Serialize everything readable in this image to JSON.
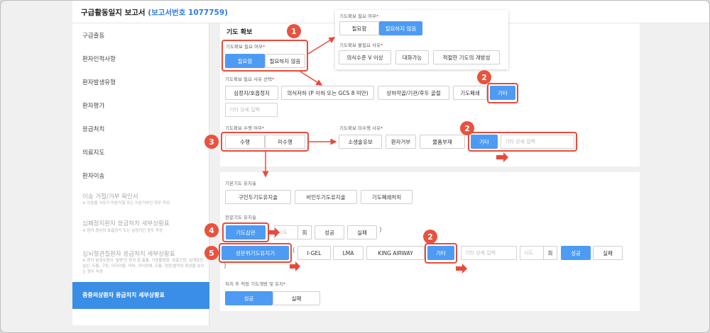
{
  "header": {
    "title": "구급활동일지 보고서",
    "report_no": "(보고서번호 1077759)"
  },
  "sidebar": {
    "items": [
      {
        "label": "구급출동"
      },
      {
        "label": "환자인적사항"
      },
      {
        "label": "환자발생유형"
      },
      {
        "label": "환자평가"
      },
      {
        "label": "응급처치"
      },
      {
        "label": "의료지도"
      },
      {
        "label": "환자이송"
      },
      {
        "label": "이송 거절/거부 확인서",
        "sub": "※ 이송을 사유가 미송거절 또는 이송거부인 경우 작성"
      },
      {
        "label": "심폐정지환자 응급처치 세부상황표",
        "sub": "※ 환자 증상이 호흡정지 또는 심정지인 경우 작성"
      },
      {
        "label": "심뇌혈관질환자 응급처치 세부상황표",
        "sub": "※ 환자 발생유형이 '질병'인 환자 중 흉통, 가슴불편함, 호흡곤란, 심계항진, 실신, 두통, 구토, 어지러움, 마비, 의식장애, 두통, 경련/발작의 증상을 보이는 경우 작성"
      },
      {
        "label": "중증외상환자 응급처치 세부상황표",
        "active": true
      }
    ]
  },
  "section_title": "기도 확보",
  "airway_need": {
    "label": "기도확보 필요 여부",
    "options": [
      "필요함",
      "필요하지 않음"
    ],
    "selected": "필요함"
  },
  "popup": {
    "need_label": "기도확보 필요 여부",
    "need_options": [
      "필요함",
      "필요하지 않음"
    ],
    "need_selected": "필요하지 않음",
    "reason_label": "기도확보 불필요 사유",
    "reasons": [
      "의식수준 V 이상",
      "대화가능",
      "적절한 기도의 개방성"
    ]
  },
  "need_reason": {
    "label": "기도확보 필요 사유 선택",
    "options": [
      "심정지/호흡정지",
      "의식저하 (P 이하 또는 GCS 8 미만)",
      "상하악골/기관/후두 골절",
      "기도폐쇄",
      "기타"
    ],
    "selected": "기타",
    "detail_placeholder": "기타 상세 입력"
  },
  "performed": {
    "label": "기도확보 수행 여부",
    "options": [
      "수행",
      "미수행"
    ]
  },
  "not_performed_reason": {
    "label": "기도확보 미수행 사유",
    "options": [
      "소생술유보",
      "환자거부",
      "물품부재",
      "기타"
    ],
    "selected": "기타",
    "detail_placeholder": "기타 상세 입력"
  },
  "basic_airway": {
    "label": "기본기도 유지술",
    "options": [
      "구인두기도유지술",
      "비인두기도유지술",
      "기도폐쇄처치"
    ]
  },
  "advanced_airway": {
    "label": "전문기도 유지술",
    "intubation": {
      "label": "기도삽관",
      "attempt_placeholder": "시도",
      "unit": "회",
      "result": [
        "성공",
        "실패"
      ]
    },
    "supraglottic": {
      "label": "성문위기도유지기",
      "options": [
        "I-GEL",
        "LMA",
        "KING AIRWAY",
        "기타"
      ],
      "selected": "기타",
      "detail_placeholder": "기타 상세 입력",
      "attempt_placeholder": "시도",
      "unit": "회",
      "result": [
        "성공",
        "실패"
      ],
      "result_selected": "성공"
    }
  },
  "post_airway": {
    "label": "처치 후 적정 기도개방 및 유지",
    "options": [
      "성공",
      "실패"
    ],
    "selected": "성공"
  },
  "callouts": [
    "1",
    "2",
    "3",
    "2",
    "4",
    "5",
    "2"
  ],
  "colors": {
    "accent": "#4d9bf3",
    "callout": "#e84a3c",
    "active_sidebar": "#3a8ee6"
  }
}
